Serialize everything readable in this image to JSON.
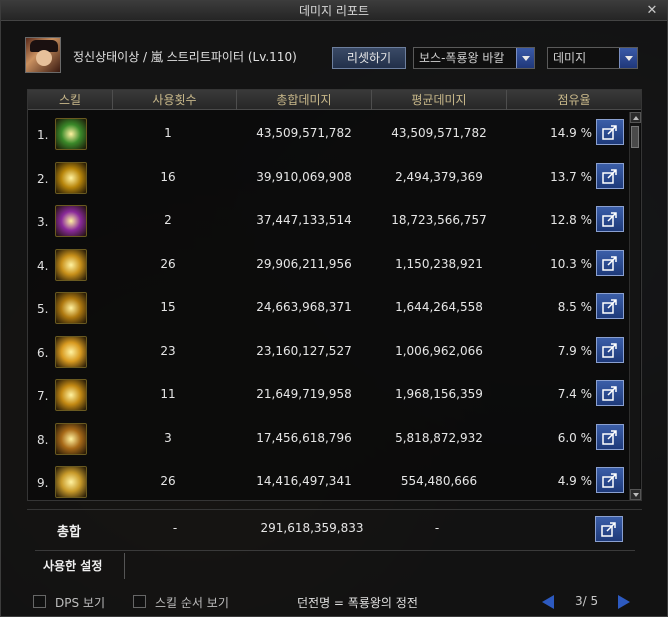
{
  "window": {
    "title": "데미지 리포트",
    "close_glyph": "✕"
  },
  "header": {
    "character": "정신상태이상 / 嵐 스트리트파이터 (Lv.110)",
    "reset_label": "리셋하기",
    "filter_dropdown": "보스-폭룡왕 바칼",
    "mode_dropdown": "데미지"
  },
  "table": {
    "columns": [
      "스킬",
      "사용횟수",
      "총합데미지",
      "평균데미지",
      "점유율"
    ],
    "rows": [
      {
        "rank": "1.",
        "uses": "1",
        "total": "43,509,571,782",
        "avg": "43,509,571,782",
        "share": "14.9 %",
        "icon_color": "#3b8a2a"
      },
      {
        "rank": "2.",
        "uses": "16",
        "total": "39,910,069,908",
        "avg": "2,494,379,369",
        "share": "13.7 %",
        "icon_color": "#b8860b"
      },
      {
        "rank": "3.",
        "uses": "2",
        "total": "37,447,133,514",
        "avg": "18,723,566,757",
        "share": "12.8 %",
        "icon_color": "#8a2a9a"
      },
      {
        "rank": "4.",
        "uses": "26",
        "total": "29,906,211,956",
        "avg": "1,150,238,921",
        "share": "10.3 %",
        "icon_color": "#c8901a"
      },
      {
        "rank": "5.",
        "uses": "15",
        "total": "24,663,968,371",
        "avg": "1,644,264,558",
        "share": "8.5 %",
        "icon_color": "#b07a10"
      },
      {
        "rank": "6.",
        "uses": "23",
        "total": "23,160,127,527",
        "avg": "1,006,962,066",
        "share": "7.9 %",
        "icon_color": "#d89a20"
      },
      {
        "rank": "7.",
        "uses": "11",
        "total": "21,649,719,958",
        "avg": "1,968,156,359",
        "share": "7.4 %",
        "icon_color": "#c48a14"
      },
      {
        "rank": "8.",
        "uses": "3",
        "total": "17,456,618,796",
        "avg": "5,818,872,932",
        "share": "6.0 %",
        "icon_color": "#a86a18"
      },
      {
        "rank": "9.",
        "uses": "26",
        "total": "14,416,497,341",
        "avg": "554,480,666",
        "share": "4.9 %",
        "icon_color": "#c89a2a"
      }
    ],
    "total": {
      "label": "총합",
      "uses": "-",
      "total": "291,618,359,833",
      "avg": "-"
    }
  },
  "settings_tab": "사용한 설정",
  "footer": {
    "dps_label": "DPS 보기",
    "order_label": "스킬 순서 보기",
    "dungeon": "던전명 = 폭룡왕의 정전",
    "page": "3/ 5"
  },
  "colors": {
    "accent": "#2d5ac0",
    "header_text": "#c8b88a",
    "button_blue": "#1e3a7a"
  }
}
